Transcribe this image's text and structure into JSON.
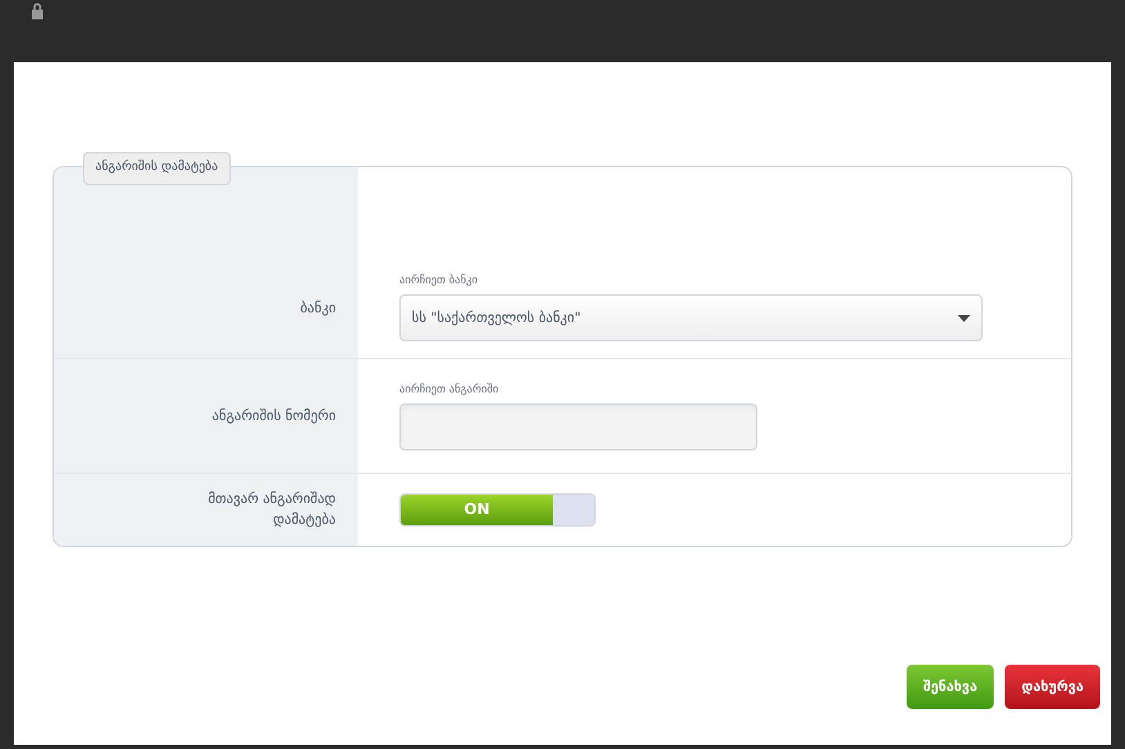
{
  "dialog": {
    "legend": "ანგარიშის დამატება",
    "fields": [
      {
        "kind": "select",
        "label": "ბანკი",
        "hint": "აირჩიეთ ბანკი",
        "value": "სს \"საქართველოს ბანკი\""
      },
      {
        "kind": "input",
        "label": "ანგარიშის ნომერი",
        "hint": "აირჩიეთ ანგარიში"
      },
      {
        "kind": "toggle",
        "label": "მთავარ ანგარიშად დამატება",
        "on": true,
        "on_text": "ON"
      }
    ],
    "buttons": [
      {
        "kind": "save",
        "label": "შენახვა"
      },
      {
        "kind": "close",
        "label": "დახურვა"
      }
    ]
  }
}
